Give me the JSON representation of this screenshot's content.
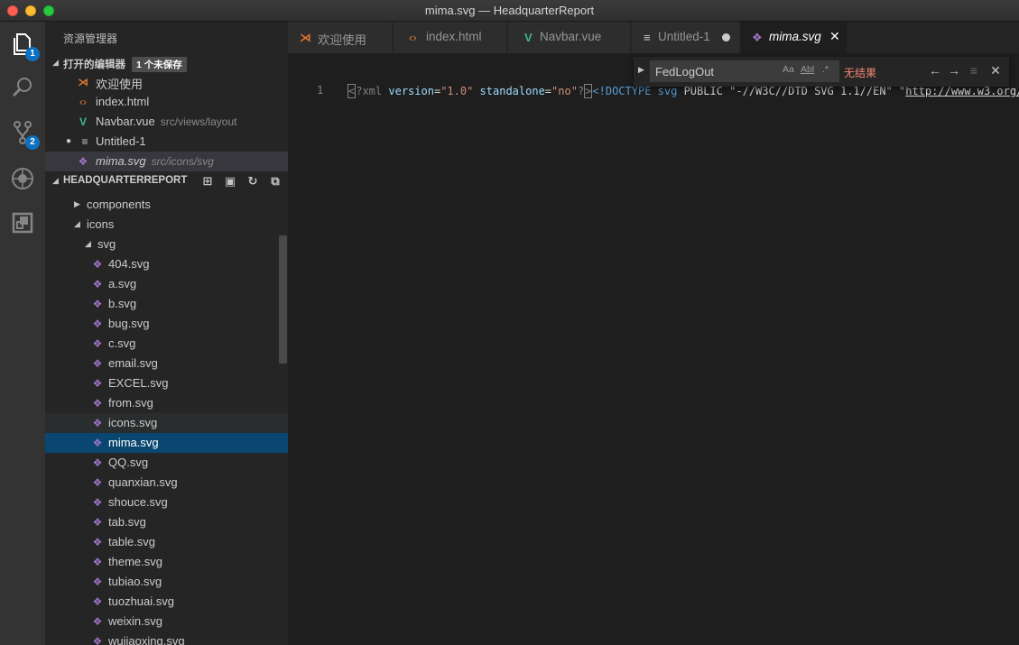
{
  "window": {
    "title": "mima.svg — HeadquarterReport"
  },
  "activity": {
    "explorer_badge": "1",
    "scm_badge": "2"
  },
  "sidebar": {
    "title": "资源管理器",
    "open_editors": {
      "label": "打开的编辑器",
      "unsaved_badge": "1 个未保存",
      "items": [
        {
          "name": "欢迎使用",
          "desc": ""
        },
        {
          "name": "index.html",
          "desc": ""
        },
        {
          "name": "Navbar.vue",
          "desc": "src/views/layout"
        },
        {
          "name": "Untitled-1",
          "desc": ""
        },
        {
          "name": "mima.svg",
          "desc": "src/icons/svg"
        }
      ]
    },
    "project": {
      "label": "HEADQUARTERREPORT",
      "folders": {
        "components": "components",
        "icons": "icons",
        "svg": "svg"
      },
      "files": [
        "404.svg",
        "a.svg",
        "b.svg",
        "bug.svg",
        "c.svg",
        "email.svg",
        "EXCEL.svg",
        "from.svg",
        "icons.svg",
        "mima.svg",
        "QQ.svg",
        "quanxian.svg",
        "shouce.svg",
        "tab.svg",
        "table.svg",
        "theme.svg",
        "tubiao.svg",
        "tuozhuai.svg",
        "weixin.svg",
        "wujiaoxing.svg"
      ]
    }
  },
  "tabs": [
    {
      "label": "欢迎使用"
    },
    {
      "label": "index.html"
    },
    {
      "label": "Navbar.vue"
    },
    {
      "label": "Untitled-1"
    },
    {
      "label": "mima.svg"
    }
  ],
  "editor": {
    "line_number": "1",
    "code": {
      "decl_open": "?xml",
      "attr1": "version",
      "val1": "\"1.0\"",
      "attr2": "standalone",
      "val2": "\"no\"",
      "decl_close": "?",
      "doctype": "<!DOCTYPE svg",
      "public": "PUBLIC",
      "public_id": "\"-//W3C//DTD SVG 1.1//EN\"",
      "quote": "\"",
      "link": "http://www.w3.org/"
    }
  },
  "find": {
    "query": "FedLogOut",
    "match_case": "Aa",
    "whole_word": "Abl",
    "regex": ".*",
    "result": "无结果"
  },
  "colors": {
    "selection": "#094771",
    "accent_blue": "#0e70c0",
    "no_result": "#f48771",
    "svg_icon": "#a074c4",
    "vue_icon": "#41b883",
    "html_icon": "#e37933"
  }
}
